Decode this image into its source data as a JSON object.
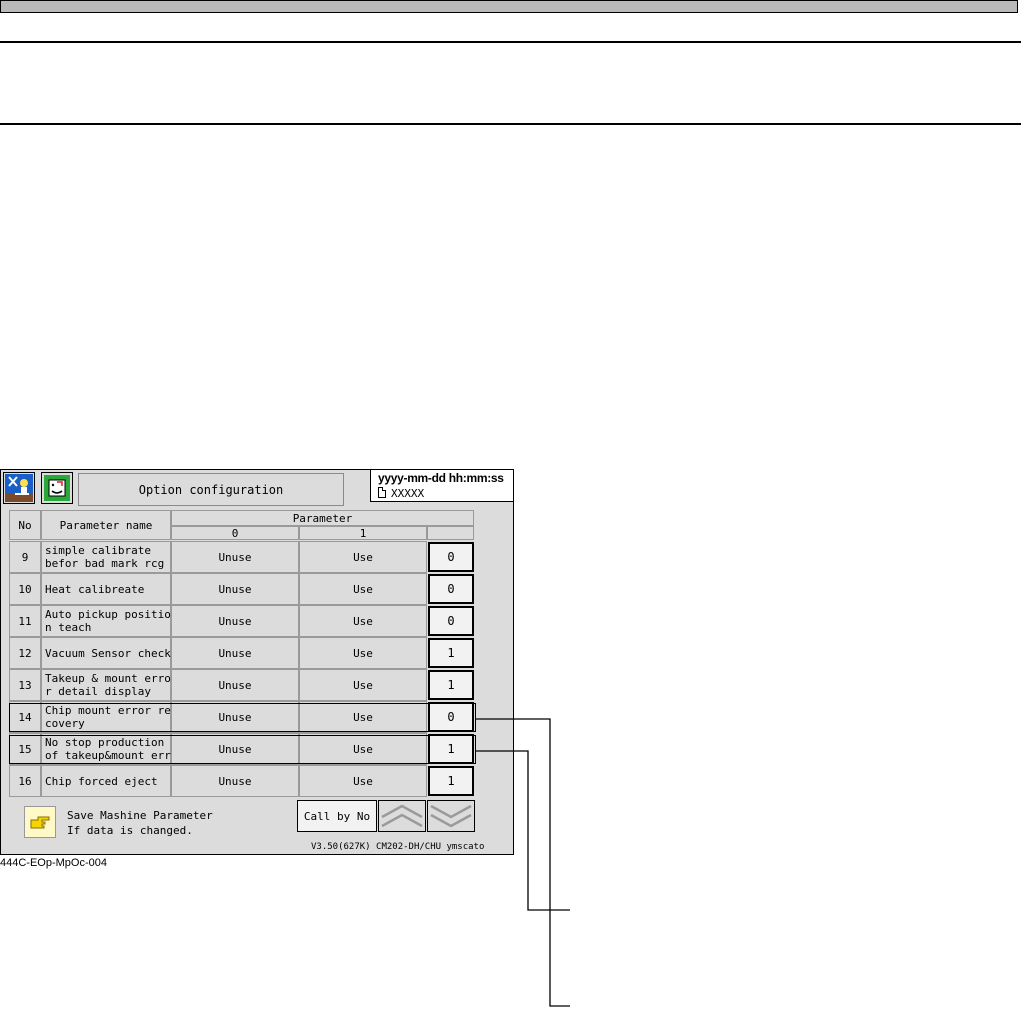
{
  "screen": {
    "title": "Option configuration",
    "clock": "yyyy-mm-dd  hh:mm:ss",
    "file_name": "XXXXX",
    "header": {
      "no": "No",
      "parameter_name": "Parameter name",
      "parameter": "Parameter",
      "opt0": "0",
      "opt1": "1"
    },
    "rows": [
      {
        "no": "9",
        "name": "simple calibrate\nbefor bad mark rcg",
        "opt0": "Unuse",
        "opt1": "Use",
        "value": "0"
      },
      {
        "no": "10",
        "name": "Heat calibreate",
        "opt0": "Unuse",
        "opt1": "Use",
        "value": "0"
      },
      {
        "no": "11",
        "name": "Auto pickup positio\nn teach",
        "opt0": "Unuse",
        "opt1": "Use",
        "value": "0"
      },
      {
        "no": "12",
        "name": "Vacuum Sensor check",
        "opt0": "Unuse",
        "opt1": "Use",
        "value": "1"
      },
      {
        "no": "13",
        "name": "Takeup & mount erro\nr detail display",
        "opt0": "Unuse",
        "opt1": "Use",
        "value": "1"
      },
      {
        "no": "14",
        "name": "Chip mount error re\ncovery",
        "opt0": "Unuse",
        "opt1": "Use",
        "value": "0"
      },
      {
        "no": "15",
        "name": "No stop production\nof takeup&mount err",
        "opt0": "Unuse",
        "opt1": "Use",
        "value": "1"
      },
      {
        "no": "16",
        "name": "Chip forced eject",
        "opt0": "Unuse",
        "opt1": "Use",
        "value": "1"
      }
    ],
    "save_line1": "Save Mashine Parameter",
    "save_line2": "If data is changed.",
    "call_by_no": "Call by No",
    "version": "V3.50(627K)   CM202-DH/CHU ymscato"
  },
  "figure_label": "444C-EOp-MpOc-004"
}
